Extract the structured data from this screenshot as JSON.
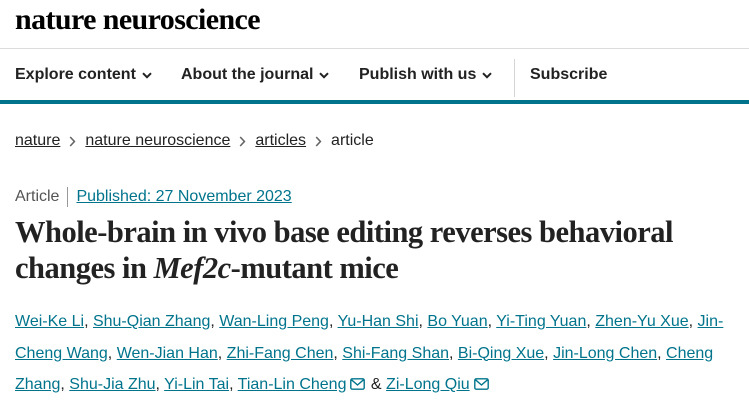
{
  "site": {
    "logo": "nature neuroscience"
  },
  "nav": {
    "items": [
      {
        "label": "Explore content"
      },
      {
        "label": "About the journal"
      },
      {
        "label": "Publish with us"
      }
    ],
    "subscribe": "Subscribe"
  },
  "breadcrumb": {
    "items": [
      "nature",
      "nature neuroscience",
      "articles"
    ],
    "current": "article"
  },
  "article": {
    "type": "Article",
    "published": "Published: 27 November 2023",
    "title_part1": "Whole-brain in vivo base editing reverses behavioral changes in ",
    "title_gene": "Mef2c",
    "title_part2": "-mutant mice",
    "authors": {
      "a1": "Wei-Ke Li",
      "a2": "Shu-Qian Zhang",
      "a3": "Wan-Ling Peng",
      "a4": "Yu-Han Shi",
      "a5": "Bo Yuan",
      "a6": "Yi-Ting Yuan",
      "a7": "Zhen-Yu Xue",
      "a8_line1": "Jin-",
      "a8_line2": "Cheng Wang",
      "a9": "Wen-Jian Han",
      "a10": "Zhi-Fang Chen",
      "a11": "Shi-Fang Shan",
      "a12": "Bi-Qing Xue",
      "a13": "Jin-Long Chen",
      "a14_line1": "Cheng",
      "a14_line2": "Zhang",
      "a15": "Shu-Jia Zhu",
      "a16": "Yi-Lin Tai",
      "a17": "Tian-Lin Cheng",
      "a18": "Zi-Long Qiu"
    },
    "comma": ", ",
    "ampersand": " & "
  },
  "colors": {
    "accent": "#01748c",
    "text": "#222222"
  },
  "icons": {
    "chevron": "chevron-down-icon",
    "crumb": "chevron-right-icon",
    "mail": "mail-icon"
  }
}
